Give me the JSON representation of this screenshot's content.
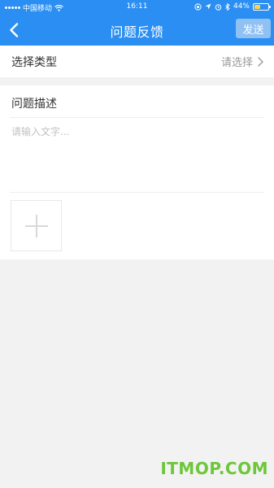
{
  "status_bar": {
    "carrier": "中国移动",
    "time": "16:11",
    "battery": "44%",
    "battery_level": 0.44
  },
  "nav": {
    "title": "问题反馈",
    "back_icon": "chevron-left-icon",
    "send_label": "发送"
  },
  "type_row": {
    "label": "选择类型",
    "value": "请选择",
    "chevron_icon": "chevron-right-icon"
  },
  "description": {
    "title": "问题描述",
    "placeholder": "请输入文字...",
    "add_image_icon": "plus-icon"
  },
  "watermark": "ITMOP.COM",
  "colors": {
    "nav_bg": "#2a8ef2",
    "send_btn_bg": "#8fc1f3",
    "page_bg": "#f2f2f2",
    "watermark": "#6cc73a"
  }
}
